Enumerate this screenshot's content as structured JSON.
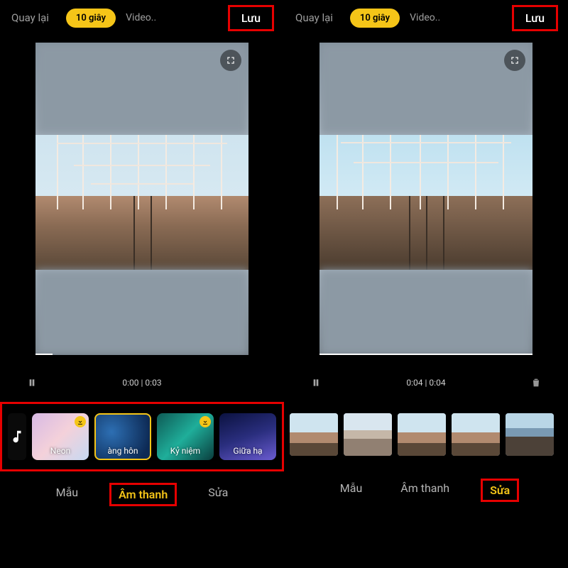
{
  "left": {
    "header": {
      "back": "Quay lại",
      "chip": "10 giây",
      "video": "Video..",
      "save": "Lưu"
    },
    "time": "0:00 | 0:03",
    "progressPct": "8%",
    "music": {
      "items": [
        {
          "label": "Neon",
          "dl": true,
          "selected": false,
          "bg": "bg-neon"
        },
        {
          "label": "àng hôn",
          "dl": false,
          "selected": true,
          "bg": "bg-anghon"
        },
        {
          "label": "Kỷ niệm",
          "dl": true,
          "selected": false,
          "bg": "bg-kyniem"
        },
        {
          "label": "Giữa hạ",
          "dl": false,
          "selected": false,
          "bg": "bg-giuaha"
        }
      ]
    },
    "tabs": {
      "t1": "Mẫu",
      "t2": "Âm thanh",
      "t3": "Sửa",
      "active": 1
    }
  },
  "right": {
    "header": {
      "back": "Quay lại",
      "chip": "10 giây",
      "video": "Video..",
      "save": "Lưu"
    },
    "time": "0:04 | 0:04",
    "progressPct": "100%",
    "clips": [
      {
        "cls": "mini-bridge"
      },
      {
        "cls": "mini-shed"
      },
      {
        "cls": "mini-bridge"
      },
      {
        "cls": "mini-bridge"
      },
      {
        "cls": "mini-tracks"
      }
    ],
    "tabs": {
      "t1": "Mẫu",
      "t2": "Âm thanh",
      "t3": "Sửa",
      "active": 2
    }
  }
}
